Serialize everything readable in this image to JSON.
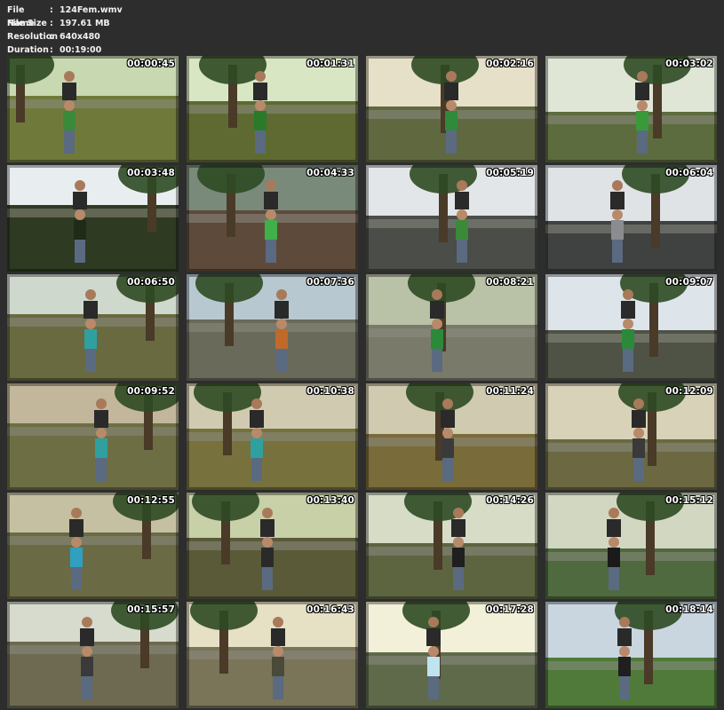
{
  "header": {
    "file_name_label": "File Name",
    "file_name": "124Fem.wmv",
    "file_size_label": "File Size",
    "file_size": "197.61 MB",
    "resolution_label": "Resolution",
    "resolution": "640x480",
    "duration_label": "Duration",
    "duration": "00:19:00",
    "separator": ":"
  },
  "thumbnails": [
    {
      "timestamp": "00:00:45",
      "scene": "park-grass-two-figures",
      "sky": "#c8d8b0",
      "ground": "#6f7a3a",
      "accent": "#3a8a3a"
    },
    {
      "timestamp": "00:01:31",
      "scene": "tree-shoulder-ride",
      "sky": "#d9e6c4",
      "ground": "#5f6a32",
      "accent": "#2a7a2a"
    },
    {
      "timestamp": "00:02:16",
      "scene": "street-poles-carry",
      "sky": "#e6e0c8",
      "ground": "#606840",
      "accent": "#2f8a3a"
    },
    {
      "timestamp": "00:03:02",
      "scene": "road-piggyback",
      "sky": "#dfe6d6",
      "ground": "#5d6c3e",
      "accent": "#3a9a3a"
    },
    {
      "timestamp": "00:03:48",
      "scene": "tree-canopy-sky",
      "sky": "#e8eef0",
      "ground": "#2f3a22",
      "accent": "#1f2a18"
    },
    {
      "timestamp": "00:04:33",
      "scene": "closeup-green-shirt",
      "sky": "#7a8a7a",
      "ground": "#5e4a3a",
      "accent": "#3fb04a"
    },
    {
      "timestamp": "00:05:19",
      "scene": "palm-street-shoulder",
      "sky": "#e3e6e8",
      "ground": "#4a4d48",
      "accent": "#3a8a3a"
    },
    {
      "timestamp": "00:06:04",
      "scene": "street-cars",
      "sky": "#dfe3e6",
      "ground": "#3f4240",
      "accent": "#8a8c90"
    },
    {
      "timestamp": "00:06:50",
      "scene": "park-bench-carry",
      "sky": "#cfd8cc",
      "ground": "#6a6a40",
      "accent": "#2fa0a0"
    },
    {
      "timestamp": "00:07:36",
      "scene": "street-town",
      "sky": "#b8c8d0",
      "ground": "#6a6a5a",
      "accent": "#c06a2a"
    },
    {
      "timestamp": "00:08:21",
      "scene": "wall-shoulder-ride",
      "sky": "#b9c1a6",
      "ground": "#7a7a6a",
      "accent": "#2a8a3a"
    },
    {
      "timestamp": "00:09:07",
      "scene": "sidewalk-wall",
      "sky": "#dde4ea",
      "ground": "#4e5346",
      "accent": "#2a8a3a"
    },
    {
      "timestamp": "00:09:52",
      "scene": "redhead-bench",
      "sky": "#c2b79a",
      "ground": "#6d6e44",
      "accent": "#2fa0a0"
    },
    {
      "timestamp": "00:10:38",
      "scene": "bench-lying",
      "sky": "#d0cbb0",
      "ground": "#77713e",
      "accent": "#2fa0a0"
    },
    {
      "timestamp": "00:11:24",
      "scene": "grass-ride",
      "sky": "#cfcab0",
      "ground": "#7a6b3a",
      "accent": "#3a3a3a"
    },
    {
      "timestamp": "00:12:09",
      "scene": "park-ride-2",
      "sky": "#d8d2b8",
      "ground": "#6b6842",
      "accent": "#3a3a3a"
    },
    {
      "timestamp": "00:12:55",
      "scene": "bench-park-cars",
      "sky": "#c6c0a2",
      "ground": "#6a6a44",
      "accent": "#2fa0c0"
    },
    {
      "timestamp": "00:13:40",
      "scene": "tilted-tree-carry",
      "sky": "#c8d0a8",
      "ground": "#5a5a38",
      "accent": "#2a2a2a"
    },
    {
      "timestamp": "00:14:26",
      "scene": "tree-shoulder-2",
      "sky": "#d6dcc6",
      "ground": "#5d6540",
      "accent": "#1f1f1f"
    },
    {
      "timestamp": "00:15:12",
      "scene": "lying-grass",
      "sky": "#d2d7c2",
      "ground": "#4e6a3e",
      "accent": "#1a1a1a"
    },
    {
      "timestamp": "00:15:57",
      "scene": "street-shoulder",
      "sky": "#d7dbce",
      "ground": "#6e6a52",
      "accent": "#3a3a3a"
    },
    {
      "timestamp": "00:16:43",
      "scene": "sunny-street",
      "sky": "#e6e0c4",
      "ground": "#7a7458",
      "accent": "#4a4a3a"
    },
    {
      "timestamp": "00:17:28",
      "scene": "sun-flare-park",
      "sky": "#f2f0d8",
      "ground": "#5e6a4a",
      "accent": "#bfe4f0"
    },
    {
      "timestamp": "00:18:14",
      "scene": "hill-shoulder",
      "sky": "#c9d6e0",
      "ground": "#4f7a3a",
      "accent": "#1f1f1f"
    }
  ]
}
